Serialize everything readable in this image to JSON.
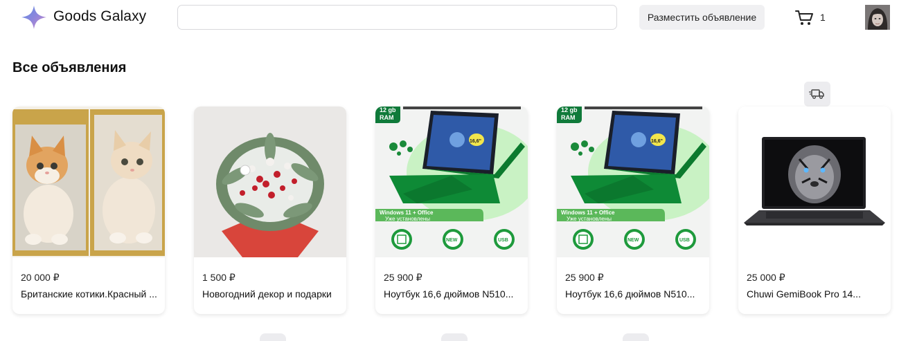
{
  "header": {
    "brand": "Goods Galaxy",
    "search_placeholder": "",
    "post_button": "Разместить объявление",
    "cart_count": "1"
  },
  "icons": {
    "logo": "star-logo-icon",
    "cart": "cart-icon",
    "delivery": "delivery-truck-icon"
  },
  "colors": {
    "accent_green": "#0f7a3a",
    "logo_gradient": [
      "#5b8fe6",
      "#c08ad6"
    ],
    "button_bg": "#f0f0f2"
  },
  "main": {
    "title": "Все объявления",
    "listings": [
      {
        "price": "20 000 ₽",
        "title": "Британские котики.Красный ..."
      },
      {
        "price": "1 500 ₽",
        "title": "Новогодний декор и подарки"
      },
      {
        "price": "25 900 ₽",
        "title": "Ноутбук 16,6 дюймов N510..."
      },
      {
        "price": "25 900 ₽",
        "title": "Ноутбук 16,6 дюймов N510..."
      },
      {
        "price": "25 000 ₽",
        "title": "Chuwi GemiBook Pro 14..."
      }
    ],
    "laptop_promo": {
      "ram": "12 gb",
      "ram_label": "RAM",
      "screen": "16,6\"",
      "banner_line1": "Windows 11 + Office",
      "banner_line2": "Уже установлены",
      "badge_new": "NEW",
      "badge_usb": "USB"
    }
  }
}
